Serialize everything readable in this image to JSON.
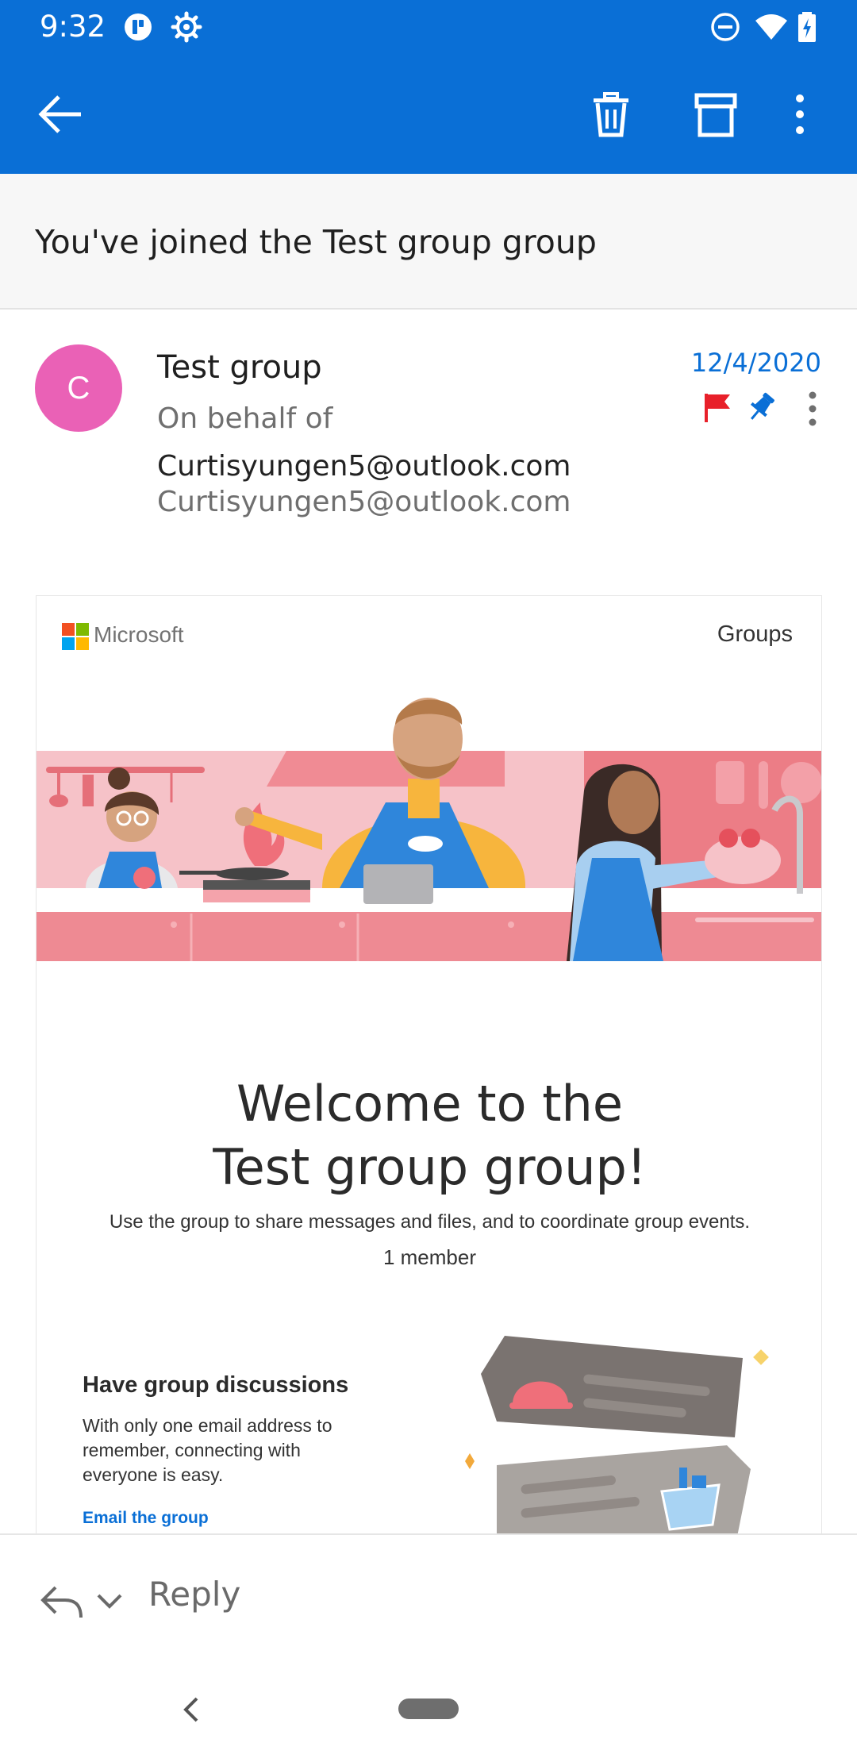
{
  "status_bar": {
    "time": "9:32",
    "left_icons": [
      "app-notification-icon",
      "settings-icon"
    ],
    "right_icons": [
      "do-not-disturb-icon",
      "wifi-icon",
      "battery-charging-icon"
    ]
  },
  "app_bar": {
    "actions": [
      "back-arrow-icon",
      "delete-icon",
      "archive-icon",
      "more-vert-icon"
    ],
    "background": "#0a6fd6"
  },
  "message": {
    "subject": "You've joined the Test group group",
    "avatar_letter": "C",
    "avatar_color": "#ea61b6",
    "sender_name": "Test group",
    "on_behalf_prefix": "On behalf of",
    "on_behalf_address": "Curtisyungen5@outlook.com",
    "sender_email": "Curtisyungen5@outlook.com",
    "date": "12/4/2020",
    "flag_color": "#e8202a",
    "pin_color": "#0a6fd6"
  },
  "body": {
    "brand": "Microsoft",
    "section_label": "Groups",
    "welcome_line1": "Welcome to the",
    "welcome_line2": "Test group group!",
    "description": "Use the group to share messages and files, and to coordinate group events.",
    "members": "1 member",
    "discussion_title": "Have group discussions",
    "discussion_text": "With only one email address to remember, connecting with everyone is easy.",
    "discussion_link": "Email the group"
  },
  "reply_bar": {
    "label": "Reply"
  }
}
